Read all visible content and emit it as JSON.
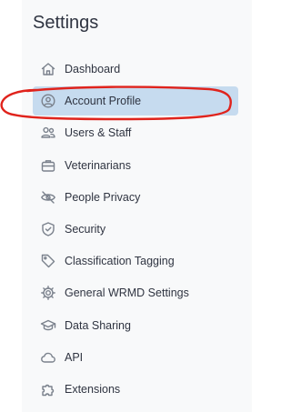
{
  "settings": {
    "title": "Settings"
  },
  "nav": {
    "items": [
      {
        "label": "Dashboard",
        "icon": "home-icon",
        "active": false
      },
      {
        "label": "Account Profile",
        "icon": "user-circle-icon",
        "active": true
      },
      {
        "label": "Users & Staff",
        "icon": "users-icon",
        "active": false
      },
      {
        "label": "Veterinarians",
        "icon": "briefcase-icon",
        "active": false
      },
      {
        "label": "People Privacy",
        "icon": "eye-off-icon",
        "active": false
      },
      {
        "label": "Security",
        "icon": "shield-check-icon",
        "active": false
      },
      {
        "label": "Classification Tagging",
        "icon": "tag-icon",
        "active": false
      },
      {
        "label": "General WRMD Settings",
        "icon": "cog-icon",
        "active": false
      },
      {
        "label": "Data Sharing",
        "icon": "graduation-cap-icon",
        "active": false
      },
      {
        "label": "API",
        "icon": "cloud-icon",
        "active": false
      },
      {
        "label": "Extensions",
        "icon": "puzzle-icon",
        "active": false
      }
    ]
  },
  "colors": {
    "active_background": "#c6dbef",
    "annotation_circle": "#e0231c"
  }
}
